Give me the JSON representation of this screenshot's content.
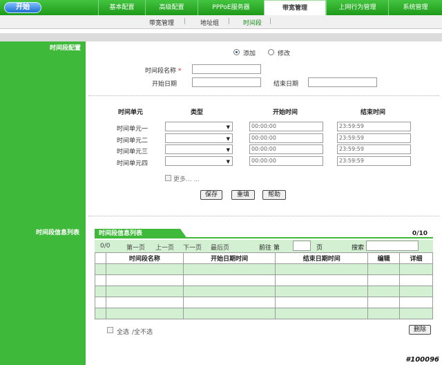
{
  "top_nav": {
    "start_label": "开始",
    "tabs": [
      {
        "label": "基本配置",
        "active": false
      },
      {
        "label": "高级配置",
        "active": false
      },
      {
        "label": "PPPoE服务器",
        "active": false
      },
      {
        "label": "带宽管理",
        "active": true
      },
      {
        "label": "上网行为管理",
        "active": false
      },
      {
        "label": "系统管理",
        "active": false
      }
    ]
  },
  "sub_nav": {
    "items": [
      {
        "label": "带宽管理",
        "active": false
      },
      {
        "label": "地址组",
        "active": false
      },
      {
        "label": "时间段",
        "active": true
      }
    ],
    "separator": "|"
  },
  "sections": {
    "config_label": "时间段配置",
    "list_label": "时间段信息列表"
  },
  "form": {
    "mode_add": "添加",
    "mode_edit": "修改",
    "mode_selected": "添加",
    "name_label": "时间段名称",
    "required_mark": "*",
    "name_value": "",
    "start_date_label": "开始日期",
    "start_date_value": "",
    "end_date_label": "结束日期",
    "end_date_value": ""
  },
  "units": {
    "headers": {
      "unit": "时间单元",
      "type": "类型",
      "start": "开始时间",
      "end": "结束时间"
    },
    "rows": [
      {
        "name": "时间单元一",
        "type": "",
        "start": "00:00:00",
        "end": "23:59:59"
      },
      {
        "name": "时间单元二",
        "type": "",
        "start": "00:00:00",
        "end": "23:59:59"
      },
      {
        "name": "时间单元三",
        "type": "",
        "start": "00:00:00",
        "end": "23:59:59"
      },
      {
        "name": "时间单元四",
        "type": "",
        "start": "00:00:00",
        "end": "23:59:59"
      }
    ],
    "more_label": "更多... ..."
  },
  "buttons": {
    "save": "保存",
    "reset": "重填",
    "help": "帮助",
    "delete": "删除"
  },
  "list": {
    "title": "时间段信息列表",
    "count": "0/10",
    "pager": {
      "position": "0/0",
      "first": "第一页",
      "prev": "上一页",
      "next": "下一页",
      "last": "最后页",
      "goto_prefix": "前往  第",
      "goto_suffix": "页",
      "search_label": "搜索",
      "goto_value": "",
      "search_value": ""
    },
    "columns": [
      "",
      "时间段名称",
      "开始日期时间",
      "结束日期时间",
      "编辑",
      "详细"
    ],
    "rows": [
      {
        "style": "alt"
      },
      {
        "style": "plain"
      },
      {
        "style": "alt"
      },
      {
        "style": "plain"
      },
      {
        "style": "alt"
      }
    ],
    "select_all": "全选",
    "select_none": "/全不选"
  },
  "watermark": "#100096"
}
